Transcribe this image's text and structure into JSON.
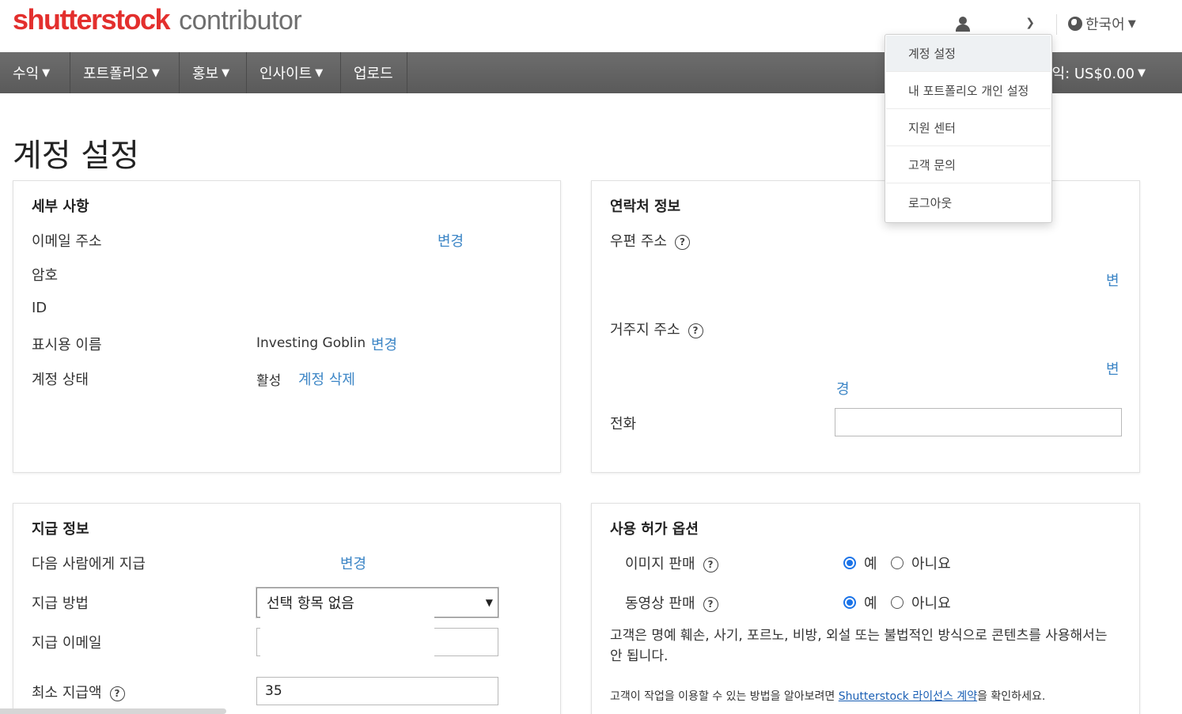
{
  "header": {
    "brand": "shutterstock",
    "brand_sub": "contributor",
    "language": "한국어"
  },
  "nav": {
    "items": [
      {
        "label": "수익",
        "has_dropdown": true
      },
      {
        "label": "포트폴리오",
        "has_dropdown": true
      },
      {
        "label": "홍보",
        "has_dropdown": true
      },
      {
        "label": "인사이트",
        "has_dropdown": true
      },
      {
        "label": "업로드",
        "has_dropdown": false
      }
    ],
    "earnings_label": "익: US$0.00"
  },
  "page_title": "계정 설정",
  "details": {
    "title": "세부 사항",
    "email_label": "이메일 주소",
    "email_change": "변경",
    "password_label": "암호",
    "id_label": "ID",
    "display_name_label": "표시용 이름",
    "display_name_value": "Investing Goblin",
    "display_name_change": "변경",
    "status_label": "계정 상태",
    "status_value": "활성",
    "delete_account": "계정 삭제"
  },
  "contact": {
    "title": "연락처 정보",
    "postal_label": "우편 주소",
    "postal_change": "변",
    "residence_label": "거주지 주소",
    "residence_change_1": "변",
    "residence_change_2": "경",
    "phone_label": "전화",
    "phone_value": ""
  },
  "payment": {
    "title": "지급 정보",
    "payee_label": "다음 사람에게 지급",
    "payee_change": "변경",
    "method_label": "지급 방법",
    "method_value": "선택 항목 없음",
    "email_label": "지급 이메일",
    "email_value": "",
    "minimum_label": "최소 지급액",
    "minimum_value": "35"
  },
  "licensing": {
    "title": "사용 허가 옵션",
    "image_label": "이미지 판매",
    "video_label": "동영상 판매",
    "yes": "예",
    "no": "아니요",
    "image_selected": "yes",
    "video_selected": "yes",
    "notice": "고객은 명예 훼손, 사기, 포르노, 비방, 외설 또는 불법적인 방식으로 콘텐츠를 사용해서는 안 됩니다.",
    "small_prefix": "고객이 작업을 이용할 수 있는 방법을 알아보려면 ",
    "small_link": "Shutterstock 라이선스 계약",
    "small_suffix": "을 확인하세요."
  },
  "user_menu": {
    "items": [
      "계정 설정",
      "내 포트폴리오 개인 설정",
      "지원 센터",
      "고객 문의",
      "로그아웃"
    ]
  },
  "colors": {
    "brand_red": "#e32f2d",
    "nav_bg": "#626262",
    "link_blue": "#3d86c6",
    "radio_blue": "#1a73e8"
  }
}
